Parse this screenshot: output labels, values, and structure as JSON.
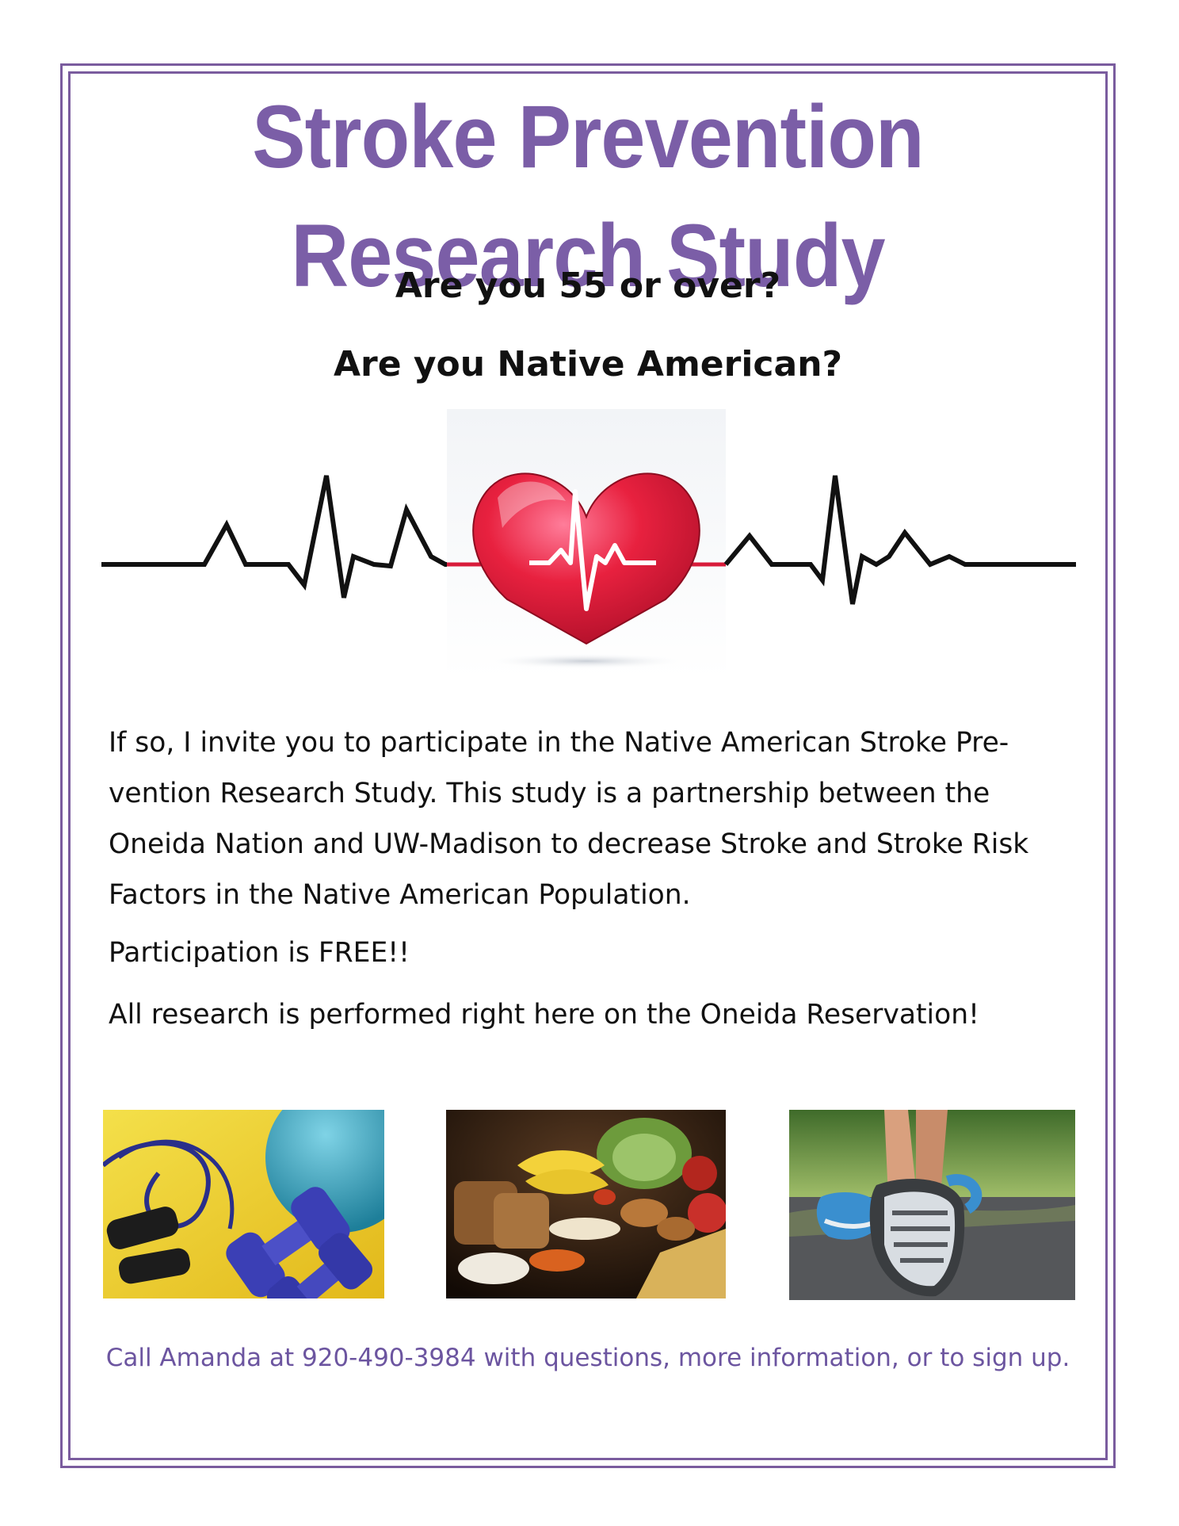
{
  "flyer": {
    "title": "Stroke Prevention Research Study",
    "question_1": "Are you 55 or over?",
    "question_2": "Are you Native American?",
    "body_paragraph": "If so, I invite you to participate in the Native American Stroke Pre-vention Research Study.  This study is a partnership between the Oneida Nation and UW-Madison to decrease Stroke and Stroke Risk Factors in the Native American Population.",
    "free_line": "Participation is FREE!!",
    "location_line": "All research is performed right here on the Oneida Reservation!",
    "contact_line": "Call Amanda at 920-490-3984 with questions, more information, or to sign up."
  },
  "images": {
    "heart": "heartbeat-heart-icon",
    "photo_1": "exercise-equipment-photo",
    "photo_2": "healthy-food-photo",
    "photo_3": "walking-shoe-photo"
  },
  "colors": {
    "accent_purple": "#7b5ea7",
    "heart_red": "#d81b3a",
    "text": "#111111"
  }
}
